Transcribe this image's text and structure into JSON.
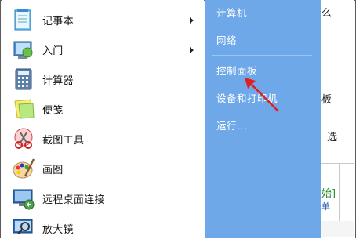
{
  "start_menu": {
    "left_items": [
      {
        "label": "记事本",
        "icon": "notepad-icon",
        "has_submenu": true
      },
      {
        "label": "入门",
        "icon": "getting-started-icon",
        "has_submenu": true
      },
      {
        "label": "计算器",
        "icon": "calculator-icon",
        "has_submenu": false
      },
      {
        "label": "便笺",
        "icon": "sticky-notes-icon",
        "has_submenu": false
      },
      {
        "label": "截图工具",
        "icon": "snipping-tool-icon",
        "has_submenu": false
      },
      {
        "label": "画图",
        "icon": "paint-icon",
        "has_submenu": false
      },
      {
        "label": "远程桌面连接",
        "icon": "remote-desktop-icon",
        "has_submenu": false
      },
      {
        "label": "放大镜",
        "icon": "magnifier-icon",
        "has_submenu": false
      }
    ],
    "right_items": [
      {
        "label": "计算机"
      },
      {
        "label": "网络"
      },
      {
        "label": "控制面板"
      },
      {
        "label": "设备和打印机"
      },
      {
        "label": "运行..."
      }
    ]
  },
  "background_window": {
    "t1": "么",
    "t2": "板",
    "t3": "选",
    "t4": "始]",
    "t5": "单"
  },
  "colors": {
    "right_pane": "#6fa8e8",
    "annotation_arrow": "#e02020"
  }
}
